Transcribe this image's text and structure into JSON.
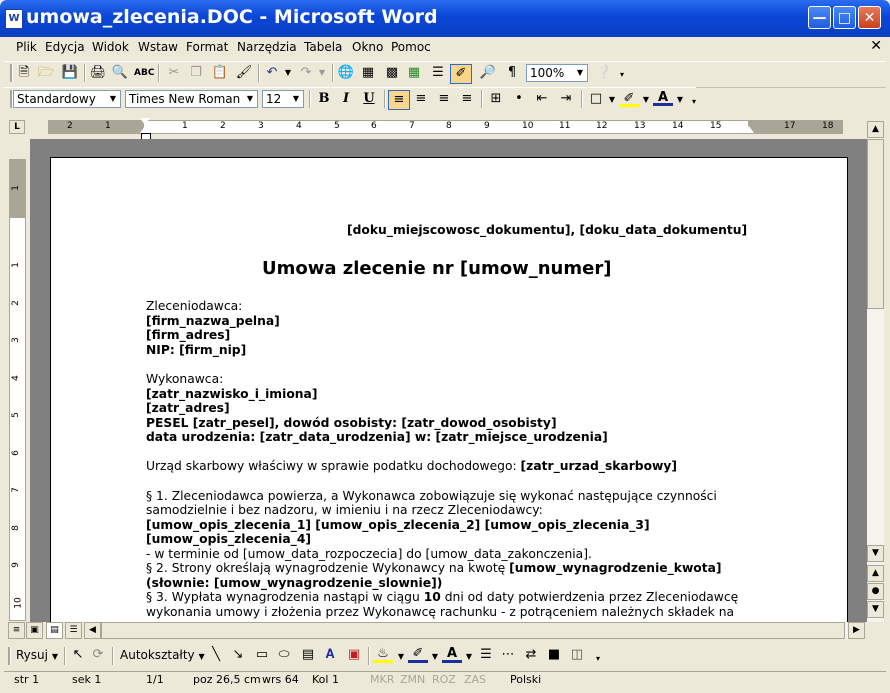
{
  "window": {
    "title": "umowa_zlecenia.DOC - Microsoft Word",
    "app_icon": "W"
  },
  "menu": [
    "Plik",
    "Edycja",
    "Widok",
    "Wstaw",
    "Format",
    "Narzędzia",
    "Tabela",
    "Okno",
    "Pomoc"
  ],
  "toolbar": {
    "zoom": "100%"
  },
  "format": {
    "style": "Standardowy",
    "font": "Times New Roman",
    "size": "12"
  },
  "ruler": {
    "h_labels": [
      "2",
      "1",
      "1",
      "2",
      "3",
      "4",
      "5",
      "6",
      "7",
      "8",
      "9",
      "10",
      "11",
      "12",
      "13",
      "14",
      "15",
      "17",
      "18"
    ],
    "v_labels": [
      "1",
      "1",
      "2",
      "3",
      "4",
      "5",
      "6",
      "7",
      "8",
      "9",
      "10"
    ]
  },
  "document": {
    "place_date": "[doku_miejscowosc_dokumentu], [doku_data_dokumentu]",
    "title": "Umowa zlecenie nr [umow_numer]",
    "lines": [
      {
        "t": "Zleceniodawca:",
        "b": false
      },
      {
        "t": "[firm_nazwa_pelna]",
        "b": true
      },
      {
        "t": "[firm_adres]",
        "b": true
      },
      {
        "t": "NIP: [firm_nip]",
        "b": true
      },
      {
        "t": "",
        "b": false
      },
      {
        "t": "Wykonawca:",
        "b": false
      },
      {
        "t": "[zatr_nazwisko_i_imiona]",
        "b": true
      },
      {
        "t": "[zatr_adres]",
        "b": true
      },
      {
        "t": "PESEL [zatr_pesel], dowód osobisty: [zatr_dowod_osobisty]",
        "b": true
      },
      {
        "t": "data urodzenia: [zatr_data_urodzenia] w: [zatr_miejsce_urodzenia]",
        "b": true
      },
      {
        "t": "",
        "b": false
      }
    ],
    "tax_label": "Urząd skarbowy właściwy w sprawie podatku dochodowego: ",
    "tax_value": "[zatr_urzad_skarbowy]",
    "p1_line1": "§ 1. Zleceniodawca powierza, a Wykonawca zobowiązuje się wykonać następujące czynności",
    "p1_line2": "samodzielnie i bez nadzoru, w imieniu i na rzecz Zleceniodawcy:",
    "p1_line3": "[umow_opis_zlecenia_1] [umow_opis_zlecenia_2] [umow_opis_zlecenia_3]",
    "p1_line4": "[umow_opis_zlecenia_4]",
    "p1_line5": "- w terminie od [umow_data_rozpoczecia] do [umow_data_zakonczenia].",
    "p2_label": "§ 2. Strony określają wynagrodzenie Wykonawcy na kwotę ",
    "p2_value": "[umow_wynagrodzenie_kwota]",
    "p2_line2": "(słownie: [umow_wynagrodzenie_slownie])",
    "p3_a": "§ 3. Wypłata wynagrodzenia nastąpi w ciągu ",
    "p3_b": "10",
    "p3_c": " dni od daty potwierdzenia przez Zleceniodawcę",
    "p3_line2": "wykonania umowy i złożenia przez Wykonawcę rachunku - z potrąceniem należnych składek na"
  },
  "drawbar": {
    "draw": "Rysuj",
    "autoshapes": "Autokształty"
  },
  "status": {
    "page": "str 1",
    "section": "sek 1",
    "pages": "1/1",
    "pos": "poz 26,5 cm",
    "line": "wrs 64",
    "col": "Kol 1",
    "rec": "MKR",
    "trk": "ZMN",
    "ext": "ROZ",
    "ovr": "ZAS",
    "lang": "Polski"
  },
  "colors": {
    "titlebar": "#0a46d6",
    "chrome": "#ece9d8",
    "docbg": "#808080"
  }
}
